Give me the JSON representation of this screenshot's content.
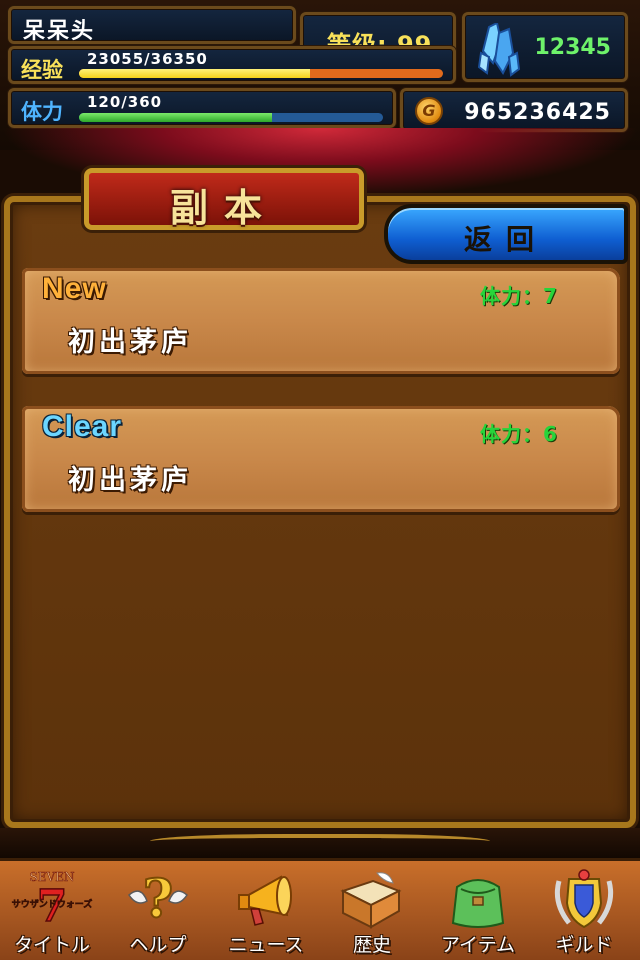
{
  "player": {
    "name": "呆呆头",
    "level_text": "等级: 99",
    "exp_label": "经验",
    "exp_value": "23055/36350",
    "exp_current": 23055,
    "exp_max": 36350,
    "stamina_label": "体力",
    "stamina_value": "120/360",
    "stamina_current": 120,
    "stamina_max": 360,
    "crystals": "12345",
    "gold": "965236425",
    "gold_icon_letter": "G"
  },
  "screen": {
    "title": "副本",
    "back_label": "返回"
  },
  "stages": [
    {
      "status": "New",
      "stamina": "体力：7",
      "name": "初出茅庐"
    },
    {
      "status": "Clear",
      "stamina": "体力：6",
      "name": "初出茅庐"
    }
  ],
  "tabs": [
    {
      "label": "タイトル",
      "icon": "title-logo-icon"
    },
    {
      "label": "ヘルプ",
      "icon": "help-icon"
    },
    {
      "label": "ニュース",
      "icon": "megaphone-icon"
    },
    {
      "label": "歴史",
      "icon": "book-icon"
    },
    {
      "label": "アイテム",
      "icon": "bag-icon"
    },
    {
      "label": "ギルド",
      "icon": "guild-crest-icon"
    }
  ],
  "logo": {
    "text_top": "SEVEN",
    "text_number": "7",
    "text_bottom": "サウザンドウォーズ"
  },
  "colors": {
    "exp_fill": "#f4d21a",
    "stamina_fill": "#2ea82a",
    "crystal_text": "#6ef26a",
    "stage_stamina": "#27d43a",
    "new_status": "#ffb13a",
    "clear_status": "#6cd6ff",
    "back_button": "#0f5fd2"
  }
}
